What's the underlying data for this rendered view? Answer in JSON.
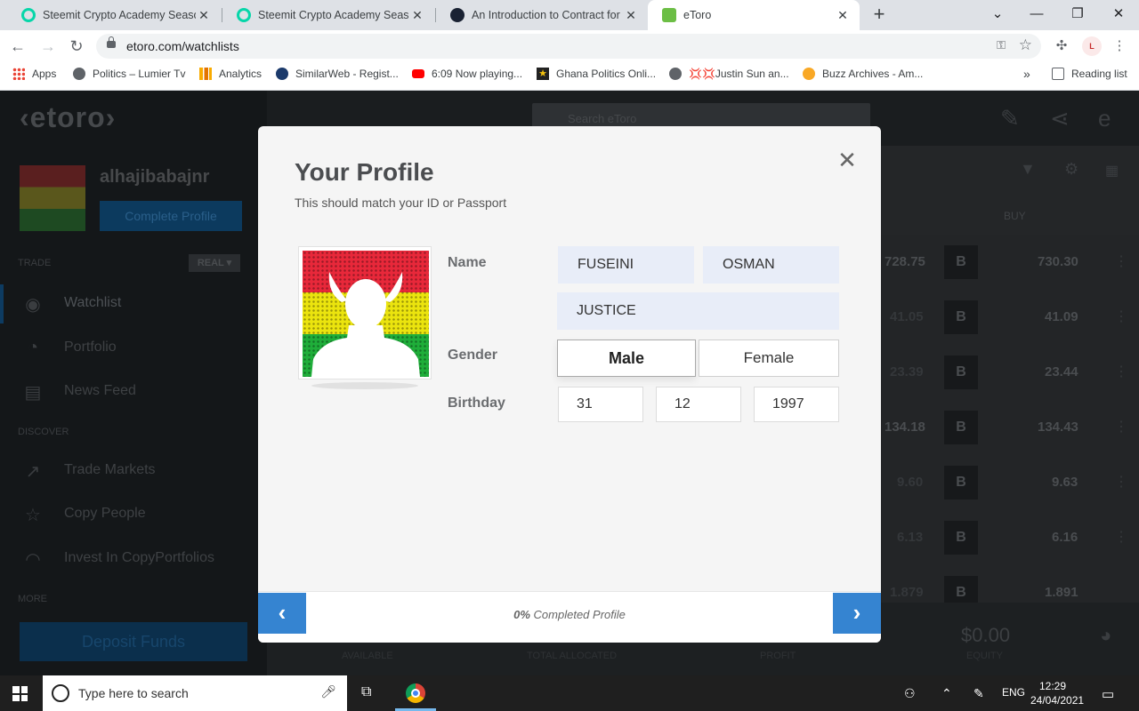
{
  "browser": {
    "tabs": [
      {
        "title": "Steemit Crypto Academy Season",
        "close": "✕",
        "favicon_color": "#06d6a9"
      },
      {
        "title": "Steemit Crypto Academy Season",
        "close": "✕",
        "favicon_color": "#06d6a9"
      },
      {
        "title": "An Introduction to Contract for D",
        "close": "✕",
        "favicon_color": "#1a2233"
      },
      {
        "title": "eToro",
        "close": "✕",
        "favicon_color": "#6cbe45"
      }
    ],
    "new_tab": "+",
    "url": "etoro.com/watchlists",
    "bookmarks": [
      {
        "label": "Apps",
        "color": "#ea4335"
      },
      {
        "label": "Politics – Lumier Tv",
        "color": "#5f6368"
      },
      {
        "label": "Analytics",
        "color": "#f9ab00"
      },
      {
        "label": "SimilarWeb - Regist...",
        "color": "#1b3a6b"
      },
      {
        "label": "6:09 Now playing...",
        "color": "#ff0000"
      },
      {
        "label": "Ghana Politics Onli...",
        "color": "#f4c20d"
      },
      {
        "label": "💢💢Justin Sun an...",
        "color": "#5f6368"
      },
      {
        "label": "Buzz Archives - Am...",
        "color": "#f9a825"
      }
    ],
    "more_bookmarks": "»",
    "reading_list": "Reading list"
  },
  "etoro": {
    "username": "alhajibabajnr",
    "complete_profile": "Complete Profile",
    "trade_label": "TRADE",
    "real_badge": "REAL ▾",
    "discover_label": "DISCOVER",
    "more_label": "MORE",
    "nav": [
      {
        "label": "Watchlist",
        "icon": "eye-icon"
      },
      {
        "label": "Portfolio",
        "icon": "pie-icon"
      },
      {
        "label": "News Feed",
        "icon": "news-icon"
      },
      {
        "label": "Trade Markets",
        "icon": "chart-icon"
      },
      {
        "label": "Copy People",
        "icon": "star-icon"
      },
      {
        "label": "Invest In CopyPortfolios",
        "icon": "portfolio-icon"
      }
    ],
    "deposit": "Deposit Funds",
    "search_placeholder": "Search eToro",
    "buy_header": "BUY",
    "rows": [
      {
        "sell": "728.75",
        "buy": "730.30"
      },
      {
        "sell": "41.05",
        "buy": "41.09"
      },
      {
        "sell": "23.39",
        "buy": "23.44"
      },
      {
        "sell": "134.18",
        "buy": "134.43"
      },
      {
        "sell": "9.60",
        "buy": "9.63"
      },
      {
        "sell": "6.13",
        "buy": "6.16"
      },
      {
        "sell": "1.879",
        "buy": "1.891"
      }
    ],
    "b_label": "B",
    "footer": {
      "available": "AVAILABLE",
      "total_allocated": "TOTAL ALLOCATED",
      "profit": "PROFIT",
      "equity": "EQUITY",
      "equity_value": "$0.00"
    }
  },
  "modal": {
    "title": "Your Profile",
    "subtitle": "This should match your ID or Passport",
    "close": "✕",
    "name_label": "Name",
    "first_name": "FUSEINI",
    "last_name": "OSMAN",
    "middle_name": "JUSTICE",
    "gender_label": "Gender",
    "gender_male": "Male",
    "gender_female": "Female",
    "gender_selected": "Male",
    "birthday_label": "Birthday",
    "birth_day": "31",
    "birth_month": "12",
    "birth_year": "1997",
    "progress_percent": "0%",
    "progress_text": "Completed Profile",
    "prev": "‹",
    "next": "›"
  },
  "taskbar": {
    "search_placeholder": "Type here to search",
    "language": "ENG",
    "time": "12:29",
    "date": "24/04/2021"
  }
}
